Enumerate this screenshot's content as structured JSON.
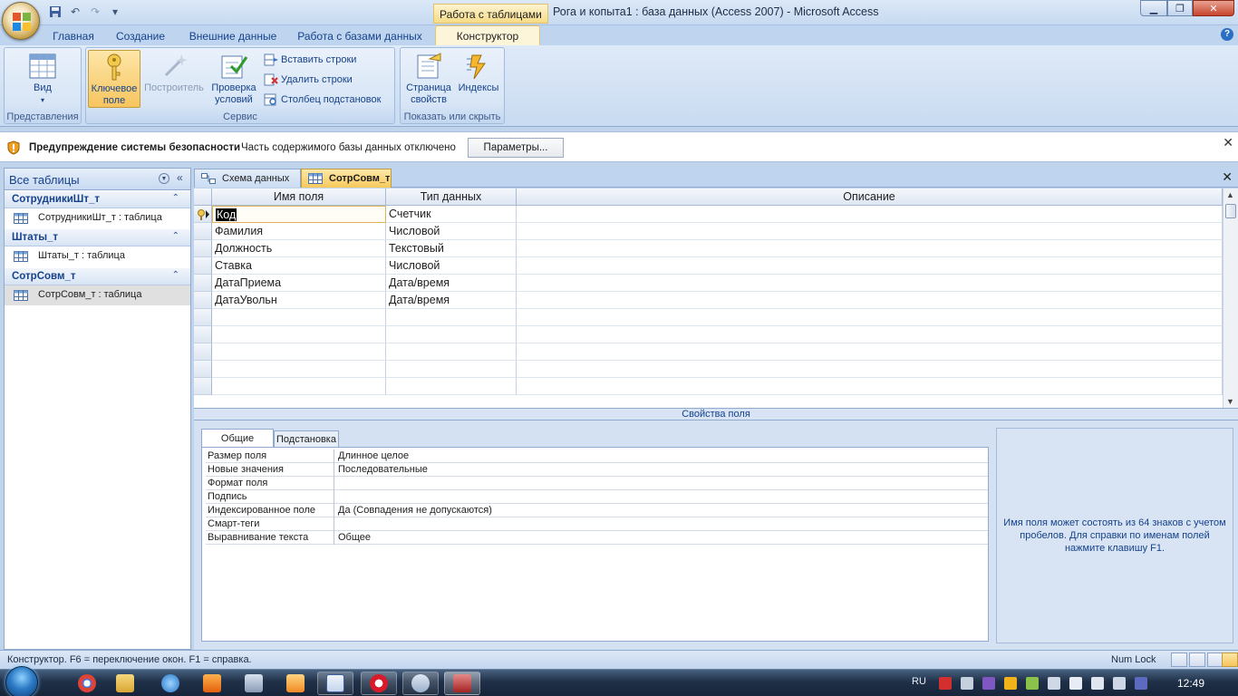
{
  "window": {
    "app_title": "Рога и копыта1 : база данных (Access 2007)  -  Microsoft Access",
    "contextual_tab": "Работа с таблицами"
  },
  "ribbon": {
    "tabs": [
      "Главная",
      "Создание",
      "Внешние данные",
      "Работа с базами данных",
      "Конструктор"
    ],
    "active_tab": "Конструктор",
    "groups": {
      "views": {
        "label": "Представления",
        "view_btn": "Вид"
      },
      "tools": {
        "label": "Сервис",
        "primary_key_line1": "Ключевое",
        "primary_key_line2": "поле",
        "builder": "Построитель",
        "test_rules_line1": "Проверка",
        "test_rules_line2": "условий",
        "insert_rows": "Вставить строки",
        "delete_rows": "Удалить строки",
        "lookup_column": "Столбец  подстановок"
      },
      "show_hide": {
        "label": "Показать или скрыть",
        "property_sheet_line1": "Страница",
        "property_sheet_line2": "свойств",
        "indexes": "Индексы"
      }
    }
  },
  "security_bar": {
    "title": "Предупреждение системы безопасности",
    "message": "Часть содержимого базы данных отключено",
    "options_button": "Параметры..."
  },
  "nav_pane": {
    "title": "Все таблицы",
    "groups": [
      {
        "name": "СотрудникиШт_т",
        "item": "СотрудникиШт_т : таблица"
      },
      {
        "name": "Штаты_т",
        "item": "Штаты_т : таблица"
      },
      {
        "name": "СотрСовм_т",
        "item": "СотрСовм_т : таблица"
      }
    ]
  },
  "doc_tabs": [
    "Схема данных",
    "СотрСовм_т"
  ],
  "design_grid": {
    "headers": [
      "Имя поля",
      "Тип данных",
      "Описание"
    ],
    "rows": [
      {
        "name": "Код",
        "type": "Счетчик",
        "desc": ""
      },
      {
        "name": "Фамилия",
        "type": "Числовой",
        "desc": ""
      },
      {
        "name": "Должность",
        "type": "Текстовый",
        "desc": ""
      },
      {
        "name": "Ставка",
        "type": "Числовой",
        "desc": ""
      },
      {
        "name": "ДатаПриема",
        "type": "Дата/время",
        "desc": ""
      },
      {
        "name": "ДатаУвольн",
        "type": "Дата/время",
        "desc": ""
      },
      {
        "name": "",
        "type": "",
        "desc": ""
      },
      {
        "name": "",
        "type": "",
        "desc": ""
      },
      {
        "name": "",
        "type": "",
        "desc": ""
      },
      {
        "name": "",
        "type": "",
        "desc": ""
      },
      {
        "name": "",
        "type": "",
        "desc": ""
      }
    ]
  },
  "field_properties": {
    "title": "Свойства поля",
    "tabs": [
      "Общие",
      "Подстановка"
    ],
    "rows": [
      {
        "label": "Размер поля",
        "value": "Длинное целое"
      },
      {
        "label": "Новые значения",
        "value": "Последовательные"
      },
      {
        "label": "Формат поля",
        "value": ""
      },
      {
        "label": "Подпись",
        "value": ""
      },
      {
        "label": "Индексированное поле",
        "value": "Да (Совпадения не допускаются)"
      },
      {
        "label": "Смарт-теги",
        "value": ""
      },
      {
        "label": "Выравнивание текста",
        "value": "Общее"
      }
    ],
    "help": "Имя поля может состоять из 64 знаков с учетом пробелов.  Для справки по именам полей нажмите клавишу F1."
  },
  "status_bar": {
    "text": "Конструктор.  F6 = переключение окон.  F1 = справка.",
    "num_lock": "Num Lock"
  },
  "taskbar": {
    "language": "RU",
    "clock": "12:49"
  },
  "colors": {
    "accent": "#f7c95c",
    "ribbon_blue": "#15428b"
  }
}
